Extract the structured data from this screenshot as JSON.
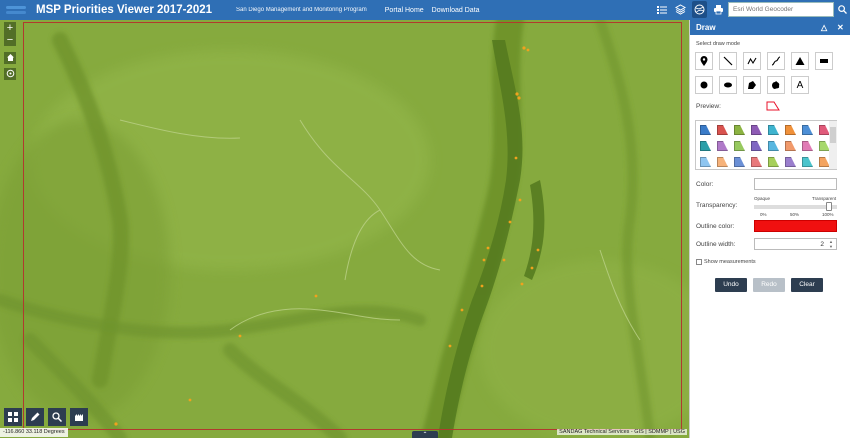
{
  "header": {
    "app_title": "MSP Priorities Viewer 2017-2021",
    "subtitle": "San Diego Management and Monitoring Program",
    "links": [
      "Portal Home",
      "Download Data"
    ],
    "icons": [
      "legend-icon",
      "layers-icon",
      "basemap-gallery-icon",
      "print-icon"
    ],
    "search_placeholder": "Esri World Geocoder",
    "brand_color": "#2f6fb5"
  },
  "map": {
    "zoom_in": "+",
    "zoom_out": "−",
    "coordinates": "-116.860 33.118 Degrees",
    "attribution": "SANDAG Technical Services - GIS | SDMMP | USG",
    "bottom_tools": [
      "app-grid-icon",
      "draw-pencil-icon",
      "magnify-icon",
      "layer-list-icon"
    ]
  },
  "draw_panel": {
    "title": "Draw",
    "select_mode_label": "Select draw mode",
    "modes": [
      "point",
      "line",
      "polyline",
      "freehand-polyline",
      "triangle",
      "rectangle",
      "circle",
      "ellipse",
      "polygon",
      "freehand-polygon",
      "text"
    ],
    "text_mode_glyph": "A",
    "preview_label": "Preview:",
    "color_label": "Color:",
    "transparency_label": "Transparency:",
    "transparency_ends": [
      "Opaque",
      "Transparent"
    ],
    "transparency_ticks": [
      "0%",
      "50%",
      "100%"
    ],
    "transparency_value": 0.9,
    "outline_color_label": "Outline color:",
    "outline_color": "#f01010",
    "outline_width_label": "Outline width:",
    "outline_width": "2",
    "show_measurements": "Show measurements",
    "buttons": {
      "undo": "Undo",
      "redo": "Redo",
      "clear": "Clear"
    },
    "symbol_colors": [
      "#3a7bc8",
      "#d9534f",
      "#8cb342",
      "#8e5bb5",
      "#3fb4cf",
      "#f0913a",
      "#4d8fd6",
      "#e05a7a",
      "#2a9fa8",
      "#b07ac9",
      "#97c95f",
      "#7f67c2",
      "#58b7e0",
      "#f19a6b",
      "#e07bb5",
      "#a7d86b",
      "#8ec5f0",
      "#f6b27a",
      "#6b90d6",
      "#e8797b",
      "#a6cf5a",
      "#9a7ecd",
      "#4cc4cc",
      "#f3a35f"
    ]
  }
}
